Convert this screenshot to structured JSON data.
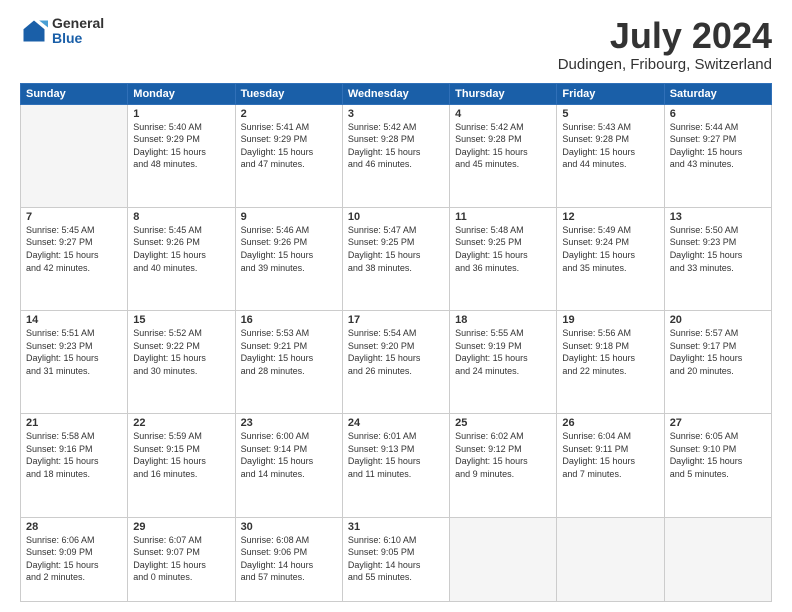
{
  "logo": {
    "general": "General",
    "blue": "Blue"
  },
  "title": "July 2024",
  "location": "Dudingen, Fribourg, Switzerland",
  "days_header": [
    "Sunday",
    "Monday",
    "Tuesday",
    "Wednesday",
    "Thursday",
    "Friday",
    "Saturday"
  ],
  "weeks": [
    [
      {
        "day": "",
        "info": ""
      },
      {
        "day": "1",
        "info": "Sunrise: 5:40 AM\nSunset: 9:29 PM\nDaylight: 15 hours\nand 48 minutes."
      },
      {
        "day": "2",
        "info": "Sunrise: 5:41 AM\nSunset: 9:29 PM\nDaylight: 15 hours\nand 47 minutes."
      },
      {
        "day": "3",
        "info": "Sunrise: 5:42 AM\nSunset: 9:28 PM\nDaylight: 15 hours\nand 46 minutes."
      },
      {
        "day": "4",
        "info": "Sunrise: 5:42 AM\nSunset: 9:28 PM\nDaylight: 15 hours\nand 45 minutes."
      },
      {
        "day": "5",
        "info": "Sunrise: 5:43 AM\nSunset: 9:28 PM\nDaylight: 15 hours\nand 44 minutes."
      },
      {
        "day": "6",
        "info": "Sunrise: 5:44 AM\nSunset: 9:27 PM\nDaylight: 15 hours\nand 43 minutes."
      }
    ],
    [
      {
        "day": "7",
        "info": "Sunrise: 5:45 AM\nSunset: 9:27 PM\nDaylight: 15 hours\nand 42 minutes."
      },
      {
        "day": "8",
        "info": "Sunrise: 5:45 AM\nSunset: 9:26 PM\nDaylight: 15 hours\nand 40 minutes."
      },
      {
        "day": "9",
        "info": "Sunrise: 5:46 AM\nSunset: 9:26 PM\nDaylight: 15 hours\nand 39 minutes."
      },
      {
        "day": "10",
        "info": "Sunrise: 5:47 AM\nSunset: 9:25 PM\nDaylight: 15 hours\nand 38 minutes."
      },
      {
        "day": "11",
        "info": "Sunrise: 5:48 AM\nSunset: 9:25 PM\nDaylight: 15 hours\nand 36 minutes."
      },
      {
        "day": "12",
        "info": "Sunrise: 5:49 AM\nSunset: 9:24 PM\nDaylight: 15 hours\nand 35 minutes."
      },
      {
        "day": "13",
        "info": "Sunrise: 5:50 AM\nSunset: 9:23 PM\nDaylight: 15 hours\nand 33 minutes."
      }
    ],
    [
      {
        "day": "14",
        "info": "Sunrise: 5:51 AM\nSunset: 9:23 PM\nDaylight: 15 hours\nand 31 minutes."
      },
      {
        "day": "15",
        "info": "Sunrise: 5:52 AM\nSunset: 9:22 PM\nDaylight: 15 hours\nand 30 minutes."
      },
      {
        "day": "16",
        "info": "Sunrise: 5:53 AM\nSunset: 9:21 PM\nDaylight: 15 hours\nand 28 minutes."
      },
      {
        "day": "17",
        "info": "Sunrise: 5:54 AM\nSunset: 9:20 PM\nDaylight: 15 hours\nand 26 minutes."
      },
      {
        "day": "18",
        "info": "Sunrise: 5:55 AM\nSunset: 9:19 PM\nDaylight: 15 hours\nand 24 minutes."
      },
      {
        "day": "19",
        "info": "Sunrise: 5:56 AM\nSunset: 9:18 PM\nDaylight: 15 hours\nand 22 minutes."
      },
      {
        "day": "20",
        "info": "Sunrise: 5:57 AM\nSunset: 9:17 PM\nDaylight: 15 hours\nand 20 minutes."
      }
    ],
    [
      {
        "day": "21",
        "info": "Sunrise: 5:58 AM\nSunset: 9:16 PM\nDaylight: 15 hours\nand 18 minutes."
      },
      {
        "day": "22",
        "info": "Sunrise: 5:59 AM\nSunset: 9:15 PM\nDaylight: 15 hours\nand 16 minutes."
      },
      {
        "day": "23",
        "info": "Sunrise: 6:00 AM\nSunset: 9:14 PM\nDaylight: 15 hours\nand 14 minutes."
      },
      {
        "day": "24",
        "info": "Sunrise: 6:01 AM\nSunset: 9:13 PM\nDaylight: 15 hours\nand 11 minutes."
      },
      {
        "day": "25",
        "info": "Sunrise: 6:02 AM\nSunset: 9:12 PM\nDaylight: 15 hours\nand 9 minutes."
      },
      {
        "day": "26",
        "info": "Sunrise: 6:04 AM\nSunset: 9:11 PM\nDaylight: 15 hours\nand 7 minutes."
      },
      {
        "day": "27",
        "info": "Sunrise: 6:05 AM\nSunset: 9:10 PM\nDaylight: 15 hours\nand 5 minutes."
      }
    ],
    [
      {
        "day": "28",
        "info": "Sunrise: 6:06 AM\nSunset: 9:09 PM\nDaylight: 15 hours\nand 2 minutes."
      },
      {
        "day": "29",
        "info": "Sunrise: 6:07 AM\nSunset: 9:07 PM\nDaylight: 15 hours\nand 0 minutes."
      },
      {
        "day": "30",
        "info": "Sunrise: 6:08 AM\nSunset: 9:06 PM\nDaylight: 14 hours\nand 57 minutes."
      },
      {
        "day": "31",
        "info": "Sunrise: 6:10 AM\nSunset: 9:05 PM\nDaylight: 14 hours\nand 55 minutes."
      },
      {
        "day": "",
        "info": ""
      },
      {
        "day": "",
        "info": ""
      },
      {
        "day": "",
        "info": ""
      }
    ]
  ]
}
